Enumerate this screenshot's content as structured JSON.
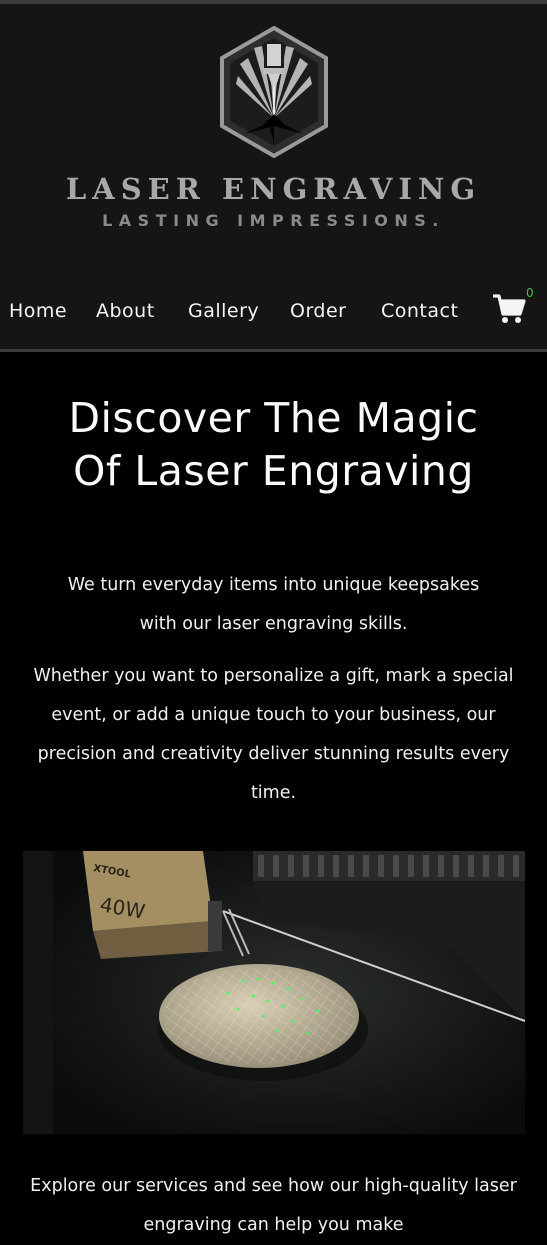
{
  "brand": {
    "title": "LASER ENGRAVING",
    "tagline": "LASTING IMPRESSIONS."
  },
  "nav": {
    "items": [
      "Home",
      "About",
      "Gallery",
      "Order",
      "Contact"
    ],
    "cart_count": "0",
    "cart_icon": "shopping-cart-icon"
  },
  "main": {
    "heading_line1": "Discover The Magic",
    "heading_line2": "Of Laser Engraving",
    "paragraph1": "We turn everyday items into unique keepsakes with our laser engraving skills.",
    "paragraph2": "Whether you want to personalize a gift, mark a special event, or add a unique touch to your business, our precision and creativity deliver stunning results every time.",
    "image_label_brand": "XTOOL",
    "image_label_power": "40W",
    "paragraph3": "Explore our services and see how our high-quality laser engraving can help you make"
  },
  "colors": {
    "header_bg": "#151515",
    "page_bg": "#000000",
    "brand_text": "#a8a8a8",
    "cart_badge": "#3fbf3f"
  }
}
